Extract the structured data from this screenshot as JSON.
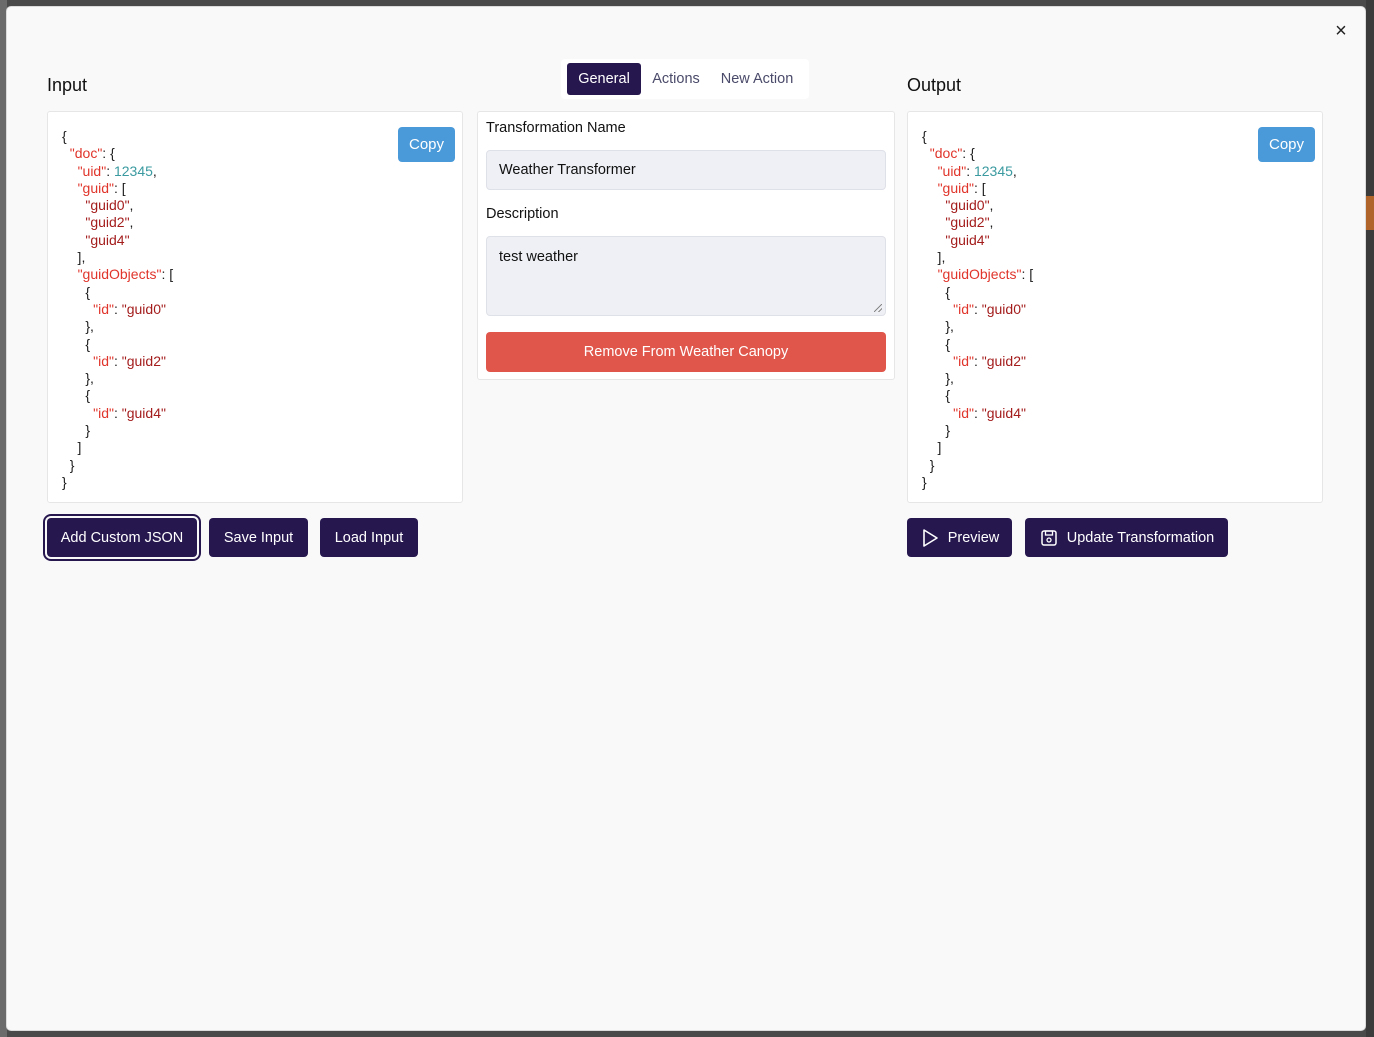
{
  "modal": {
    "close_label": "×"
  },
  "input": {
    "title": "Input",
    "copy_label": "Copy",
    "json_lines": [
      [
        "{"
      ],
      [
        "  ",
        {
          "k": "\"doc\""
        },
        ": {"
      ],
      [
        "    ",
        {
          "k": "\"uid\""
        },
        ": ",
        {
          "n": "12345"
        },
        ","
      ],
      [
        "    ",
        {
          "k": "\"guid\""
        },
        ": ["
      ],
      [
        "      ",
        {
          "s": "\"guid0\""
        },
        ","
      ],
      [
        "      ",
        {
          "s": "\"guid2\""
        },
        ","
      ],
      [
        "      ",
        {
          "s": "\"guid4\""
        }
      ],
      [
        "    ],"
      ],
      [
        "    ",
        {
          "k": "\"guidObjects\""
        },
        ": ["
      ],
      [
        "      {"
      ],
      [
        "        ",
        {
          "k": "\"id\""
        },
        ": ",
        {
          "s": "\"guid0\""
        }
      ],
      [
        "      },"
      ],
      [
        "      {"
      ],
      [
        "        ",
        {
          "k": "\"id\""
        },
        ": ",
        {
          "s": "\"guid2\""
        }
      ],
      [
        "      },"
      ],
      [
        "      {"
      ],
      [
        "        ",
        {
          "k": "\"id\""
        },
        ": ",
        {
          "s": "\"guid4\""
        }
      ],
      [
        "      }"
      ],
      [
        "    ]"
      ],
      [
        "  }"
      ],
      [
        "}"
      ]
    ],
    "buttons": {
      "add_custom_json": "Add Custom JSON",
      "save_input": "Save Input",
      "load_input": "Load Input"
    }
  },
  "tabs": [
    {
      "label": "General",
      "active": true
    },
    {
      "label": "Actions",
      "active": false
    },
    {
      "label": "New Action",
      "active": false
    }
  ],
  "form": {
    "name_label": "Transformation Name",
    "name_value": "Weather Transformer",
    "description_label": "Description",
    "description_value": "test weather",
    "remove_label": "Remove From Weather Canopy"
  },
  "output": {
    "title": "Output",
    "copy_label": "Copy",
    "buttons": {
      "preview": "Preview",
      "update": "Update Transformation"
    }
  },
  "colors": {
    "primary": "#27174f",
    "copy": "#4a9ad9",
    "danger": "#e0564a",
    "json_key": "#e0352b",
    "json_string": "#a41d1d",
    "json_number": "#3a9aa0"
  },
  "icons": [
    "close-icon",
    "play-icon",
    "save-icon"
  ]
}
